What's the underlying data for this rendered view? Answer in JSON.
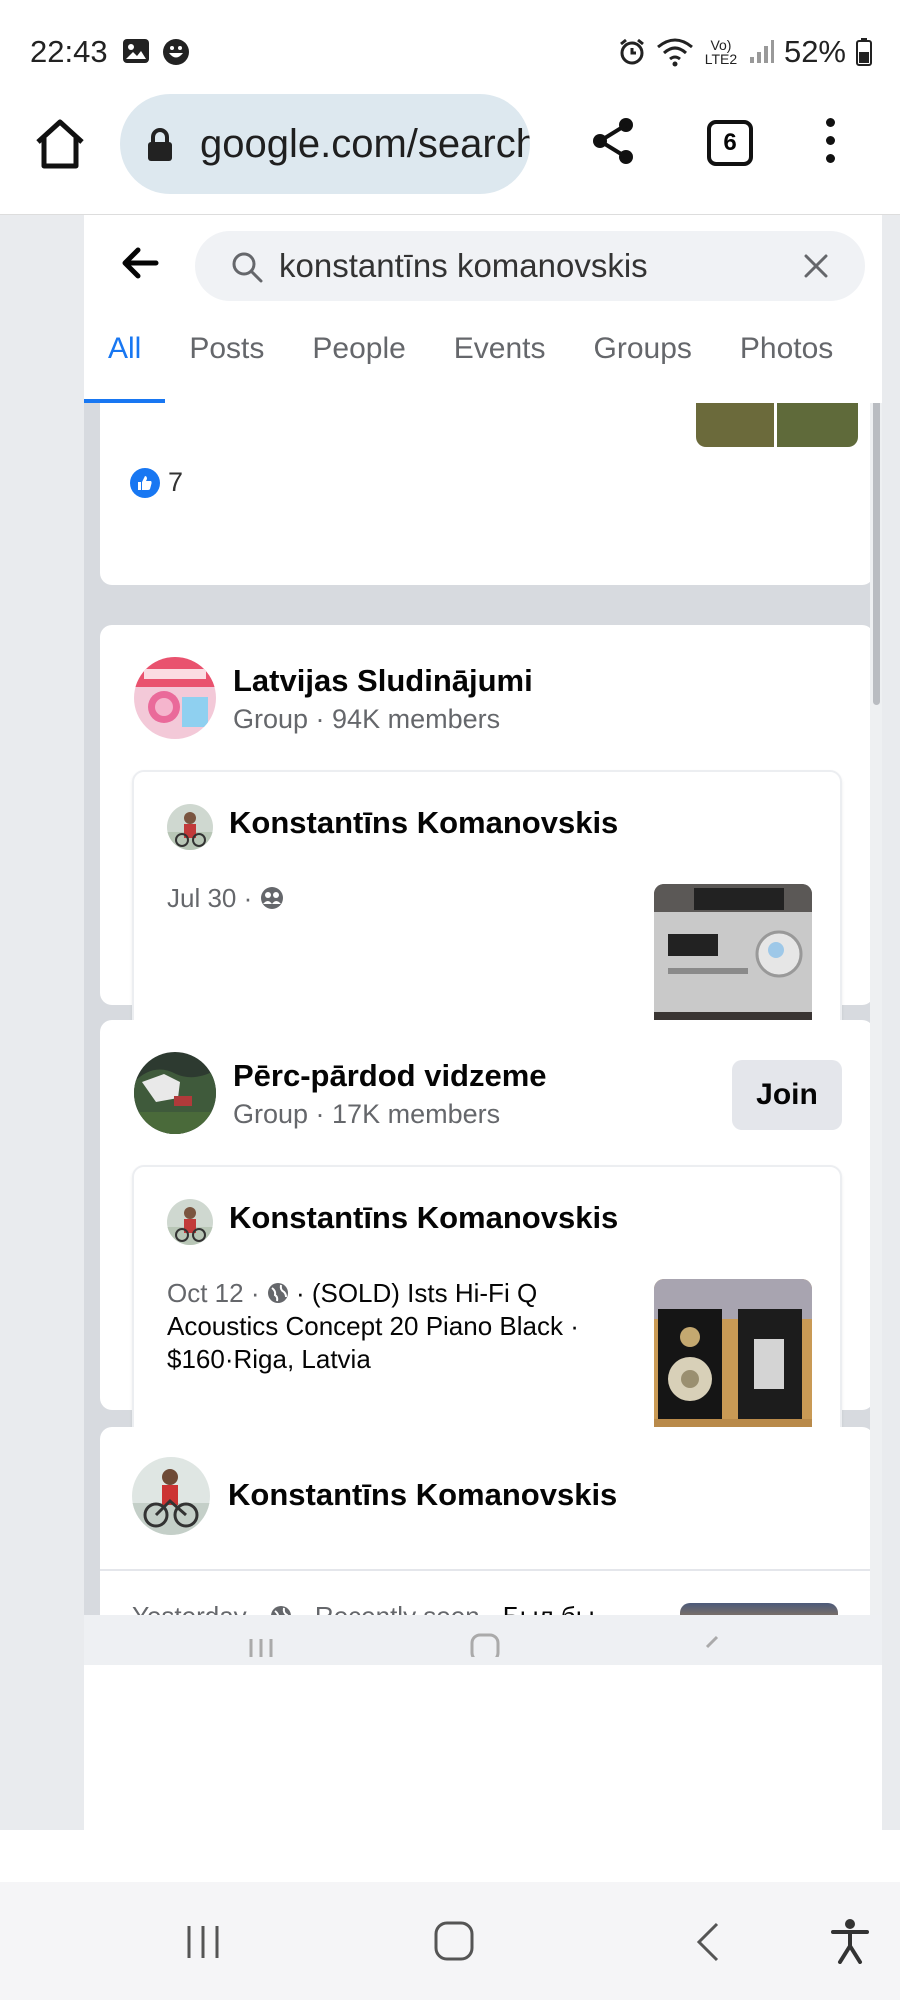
{
  "status_bar": {
    "time": "22:43",
    "network": "Vo) LTE2",
    "battery": "52%"
  },
  "browser": {
    "url": "google.com/search",
    "tab_count": "6"
  },
  "search": {
    "query": "konstantīns komanovskis"
  },
  "tabs": [
    "All",
    "Posts",
    "People",
    "Events",
    "Groups",
    "Photos"
  ],
  "top_card": {
    "reaction_count": "7"
  },
  "group1": {
    "name": "Latvijas Sludinājumi",
    "meta": "Group · 94K members",
    "post": {
      "author": "Konstantīns Komanovskis",
      "date": "Jul 30 ·"
    }
  },
  "group2": {
    "name": "Pērc-pārdod vidzeme",
    "meta": "Group · 17K members",
    "join_label": "Join",
    "post": {
      "author": "Konstantīns Komanovskis",
      "date": "Oct 12 ·",
      "text": " · (SOLD) Ists Hi-Fi Q Acoustics Concept 20 Piano Black · $160·Riga, Latvia"
    }
  },
  "profile_post": {
    "author": "Konstantīns Komanovskis",
    "meta": "Yesterday ·",
    "seen": " · Recently seen · ",
    "text": "Был бы ноябрь весь таким..😌👌"
  },
  "colors": {
    "facebook_blue": "#1877f2",
    "url_pill": "#dde8ef",
    "page_gray": "#d7dadf"
  }
}
